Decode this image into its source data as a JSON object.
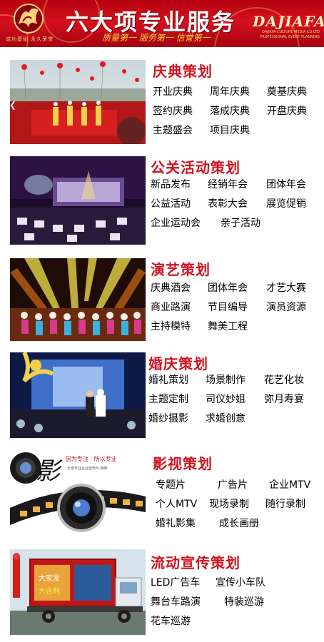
{
  "header": {
    "title": "六大项专业服务",
    "slogan": "质量第一  服务第一  信誉第一",
    "brand": "DAJIAFA",
    "brand_sub_1": "DAJIAFA CULTURE MEDIA CO LTD",
    "brand_sub_2": "PROFESSIONAL EVENT PLANNING",
    "logo_caption": "成功基础 永久荣誉",
    "colors": {
      "banner": "#c8101b",
      "title": "#ffffff",
      "slogan": "#ffd53a",
      "section_title": "#d4121e"
    }
  },
  "sections": [
    {
      "title": "庆典策划",
      "rows": [
        [
          "开业庆典",
          "周年庆典",
          "奠基庆典"
        ],
        [
          "签约庆典",
          "落成庆典",
          "开盘庆典"
        ],
        [
          "主题盛会",
          "项目庆典"
        ]
      ],
      "photo": "celebration-stage-with-balloons"
    },
    {
      "title": "公关活动策划",
      "rows": [
        [
          "新品发布",
          "经销年会",
          "团体年会"
        ],
        [
          "公益活动",
          "表彰大会",
          "展览促销"
        ],
        [
          "企业运动会",
          "亲子活动"
        ]
      ],
      "photo": "purple-conference-hall"
    },
    {
      "title": "演艺策划",
      "rows": [
        [
          "庆典酒会",
          "团体年会",
          "才艺大赛"
        ],
        [
          "商业路演",
          "节目编导",
          "演员资源"
        ],
        [
          "主持模特",
          "舞美工程"
        ]
      ],
      "photo": "stage-performance-lights"
    },
    {
      "title": "婚庆策划",
      "rows": [
        [
          "婚礼策划",
          "场景制作",
          "花艺化妆"
        ],
        [
          "主题定制",
          "司仪妙姐",
          "弥月寿宴"
        ],
        [
          "婚纱摄影",
          "求婚创意"
        ]
      ],
      "photo": "wedding-stage-blue"
    },
    {
      "title": "影视策划",
      "rows": [
        [
          "专题片",
          "广告片",
          "企业MTV"
        ],
        [
          "个人MTV",
          "现场录制",
          "随行录制"
        ],
        [
          "婚礼影集",
          "成长画册"
        ]
      ],
      "photo": "film-reel-lens",
      "photo_text_1": "因为专注 · 所以专业",
      "photo_text_2": "北京专业企业宣传片·摄像",
      "photo_glyph": "影"
    },
    {
      "title": "流动宣传策划",
      "rows": [
        [
          "LED广告车",
          "宣传小车队"
        ],
        [
          "舞台车路演",
          "特装巡游"
        ],
        [
          "花车巡游"
        ]
      ],
      "photo": "led-advertising-truck",
      "truck_text_1": "大家发",
      "truck_text_2": "大吉利"
    }
  ]
}
